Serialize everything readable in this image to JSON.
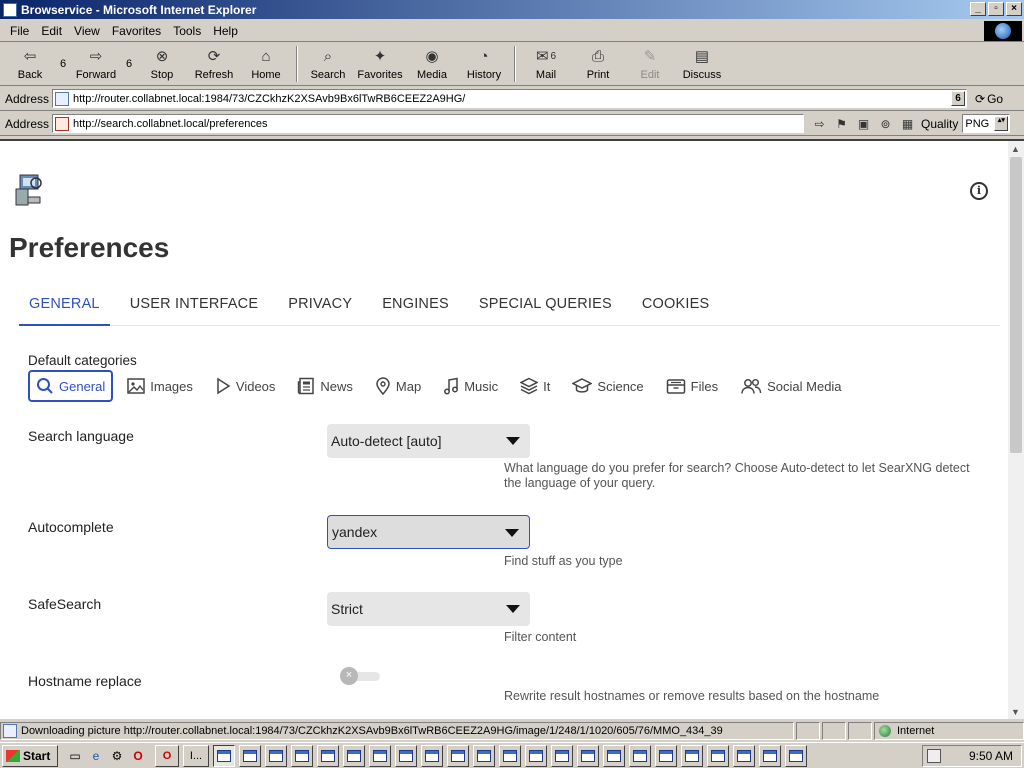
{
  "window": {
    "title": "Browservice - Microsoft Internet Explorer",
    "buttons": {
      "minimize": "_",
      "maximize": "▫",
      "close": "×"
    }
  },
  "menu": [
    "File",
    "Edit",
    "View",
    "Favorites",
    "Tools",
    "Help"
  ],
  "toolbar": {
    "back": "Back",
    "back_count": "6",
    "forward": "Forward",
    "forward_count": "6",
    "stop": "Stop",
    "refresh": "Refresh",
    "home": "Home",
    "search": "Search",
    "favorites": "Favorites",
    "media": "Media",
    "history": "History",
    "mail": "Mail",
    "mail_count": "6",
    "print": "Print",
    "edit": "Edit",
    "discuss": "Discuss"
  },
  "address_bar": {
    "label": "Address",
    "url": "http://router.collabnet.local:1984/73/CZCkhzK2XSAvb9Bx6lTwRB6CEEZ2A9HG/",
    "dropdown": "6",
    "go": "Go"
  },
  "inner_address_bar": {
    "label": "Address",
    "url": "http://search.collabnet.local/preferences",
    "quality_label": "Quality",
    "quality_value": "PNG"
  },
  "page": {
    "title": "Preferences",
    "info": "i",
    "tabs": [
      {
        "label": "GENERAL",
        "active": true
      },
      {
        "label": "USER INTERFACE"
      },
      {
        "label": "PRIVACY"
      },
      {
        "label": "ENGINES"
      },
      {
        "label": "SPECIAL QUERIES"
      },
      {
        "label": "COOKIES"
      }
    ],
    "default_categories": {
      "label": "Default categories",
      "items": [
        "General",
        "Images",
        "Videos",
        "News",
        "Map",
        "Music",
        "It",
        "Science",
        "Files",
        "Social Media"
      ],
      "selected": "General"
    },
    "search_language": {
      "label": "Search language",
      "value": "Auto-detect [auto]",
      "help": "What language do you prefer for search? Choose Auto-detect to let SearXNG detect the language of your query."
    },
    "autocomplete": {
      "label": "Autocomplete",
      "value": "yandex",
      "help": "Find stuff as you type"
    },
    "safesearch": {
      "label": "SafeSearch",
      "value": "Strict",
      "help": "Filter content"
    },
    "hostname_replace": {
      "label": "Hostname replace",
      "toggle_glyph": "×",
      "enabled": false,
      "help": "Rewrite result hostnames or remove results based on the hostname"
    }
  },
  "status": {
    "text": "Downloading picture http://router.collabnet.local:1984/73/CZCkhzK2XSAvb9Bx6lTwRB6CEEZ2A9HG/image/1/248/1/1020/605/76/MMO_434_39",
    "zone": "Internet"
  },
  "taskbar": {
    "start": "Start",
    "task_label": "I...",
    "clock": "9:50 AM"
  },
  "colors": {
    "accent": "#3050c0",
    "titlebar_start": "#0a246a",
    "titlebar_end": "#a6caf0"
  }
}
